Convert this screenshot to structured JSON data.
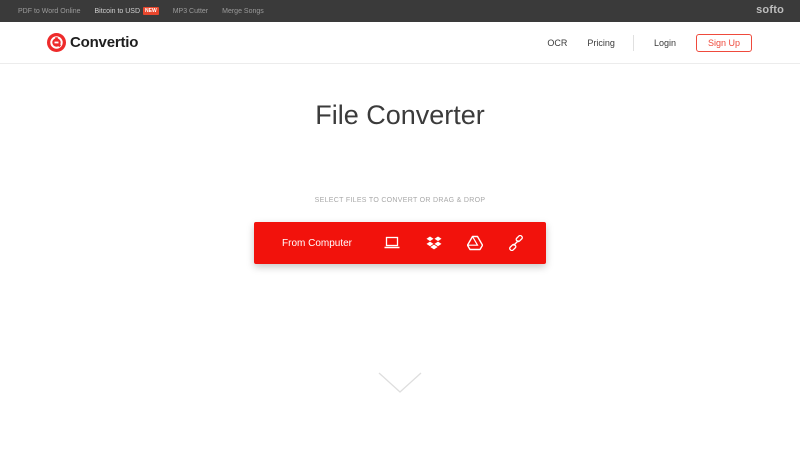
{
  "topbar": {
    "links": [
      {
        "label": "PDF to Word Online"
      },
      {
        "label": "Bitcoin to USD",
        "badge": "NEW"
      },
      {
        "label": "MP3 Cutter"
      },
      {
        "label": "Merge Songs"
      }
    ],
    "brand": "softo"
  },
  "navbar": {
    "logo_text": "Convertio",
    "links": [
      {
        "label": "OCR"
      },
      {
        "label": "Pricing"
      }
    ],
    "login_label": "Login",
    "signup_label": "Sign Up"
  },
  "main": {
    "title": "File Converter",
    "hint": "SELECT FILES TO CONVERT OR DRAG & DROP",
    "upload_label": "From Computer",
    "sources": [
      "laptop-icon",
      "dropbox-icon",
      "google-drive-icon",
      "url-link-icon"
    ]
  },
  "colors": {
    "accent": "#f2120c",
    "topbar": "#3a3a3a",
    "signup_border": "#ef4a3c"
  }
}
